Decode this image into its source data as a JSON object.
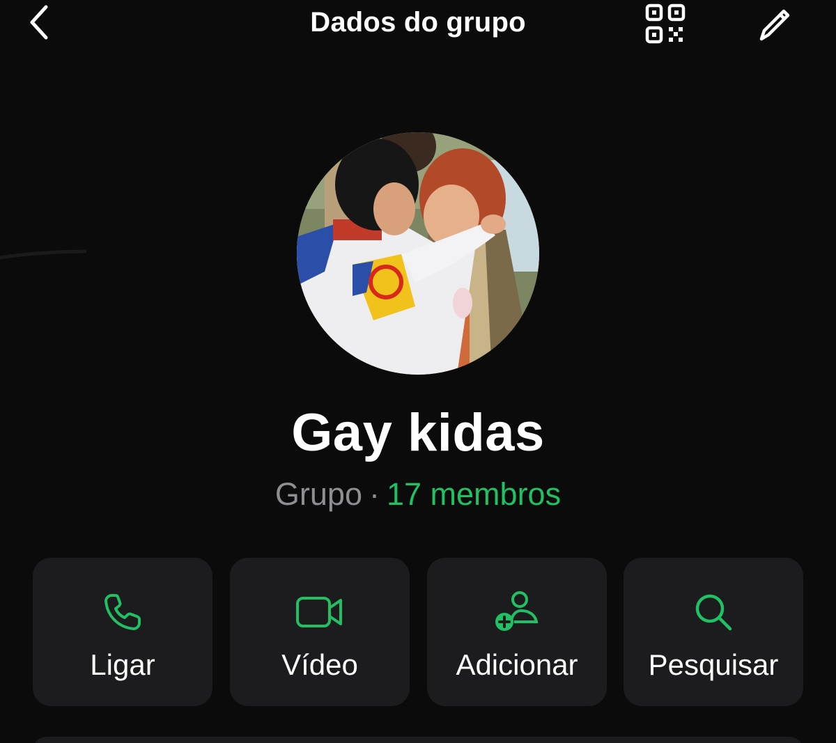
{
  "header": {
    "title": "Dados do grupo",
    "back_icon": "chevron-left-icon",
    "qr_icon": "qr-code-icon",
    "edit_icon": "pencil-icon"
  },
  "group": {
    "name": "Gay kidas",
    "type_label": "Grupo",
    "separator": "·",
    "members_label": "17 membros"
  },
  "actions": [
    {
      "label": "Ligar",
      "icon": "phone-icon"
    },
    {
      "label": "Vídeo",
      "icon": "video-camera-icon"
    },
    {
      "label": "Adicionar",
      "icon": "add-person-icon"
    },
    {
      "label": "Pesquisar",
      "icon": "search-icon"
    }
  ],
  "colors": {
    "background": "#0b0b0b",
    "card": "#1c1c1e",
    "accent_green": "#21c063",
    "secondary_text": "#8e8e93",
    "primary_text": "#ffffff"
  }
}
